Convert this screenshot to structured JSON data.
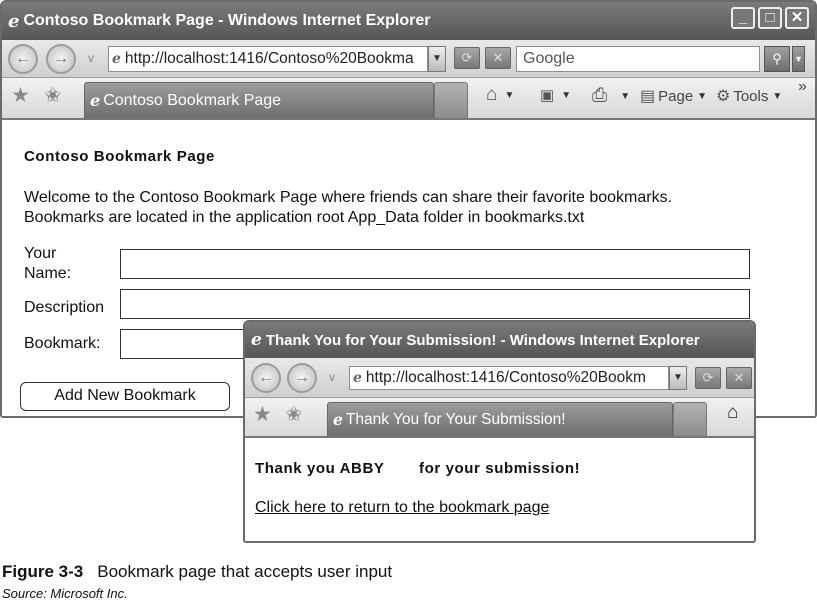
{
  "main_window": {
    "title": "Contoso Bookmark Page - Windows Internet Explorer",
    "address_url": "http://localhost:1416/Contoso%20Bookma",
    "search_placeholder": "Google",
    "tab_label": "Contoso Bookmark Page",
    "page_menu": "Page",
    "tools_menu": "Tools",
    "chevron": "»",
    "page": {
      "heading": "Contoso Bookmark Page",
      "welcome_line1": "Welcome to the Contoso Bookmark Page where friends can share their favorite bookmarks.",
      "welcome_line2": "Bookmarks are located in the application root App_Data folder in bookmarks.txt",
      "your_name_label_line1": "Your",
      "your_name_label_line2": "Name:",
      "description_label": "Description",
      "bookmark_label": "Bookmark:",
      "add_button": "Add New Bookmark"
    }
  },
  "popup_window": {
    "title": "Thank You for Your Submission! - Windows Internet Explorer",
    "address_url": "http://localhost:1416/Contoso%20Bookm",
    "tab_label": "Thank You for Your Submission!",
    "page": {
      "thank_you_prefix": "Thank you ABBY",
      "thank_you_suffix": "for your submission!",
      "return_link": "Click here to return to the bookmark page"
    }
  },
  "figure": {
    "number": "Figure 3-3",
    "caption": "Bookmark page that accepts user input",
    "source": "Source: Microsoft Inc."
  },
  "colors": {
    "titlebar": "#666666",
    "tab_active": "#858585",
    "chrome_light": "#e0e0e0"
  },
  "icons": [
    "back-icon",
    "forward-icon",
    "ie-logo-icon",
    "refresh-icon",
    "stop-icon",
    "search-icon",
    "favorites-star-icon",
    "add-favorites-icon",
    "home-icon",
    "feeds-icon",
    "print-icon",
    "page-icon",
    "tools-icon"
  ]
}
